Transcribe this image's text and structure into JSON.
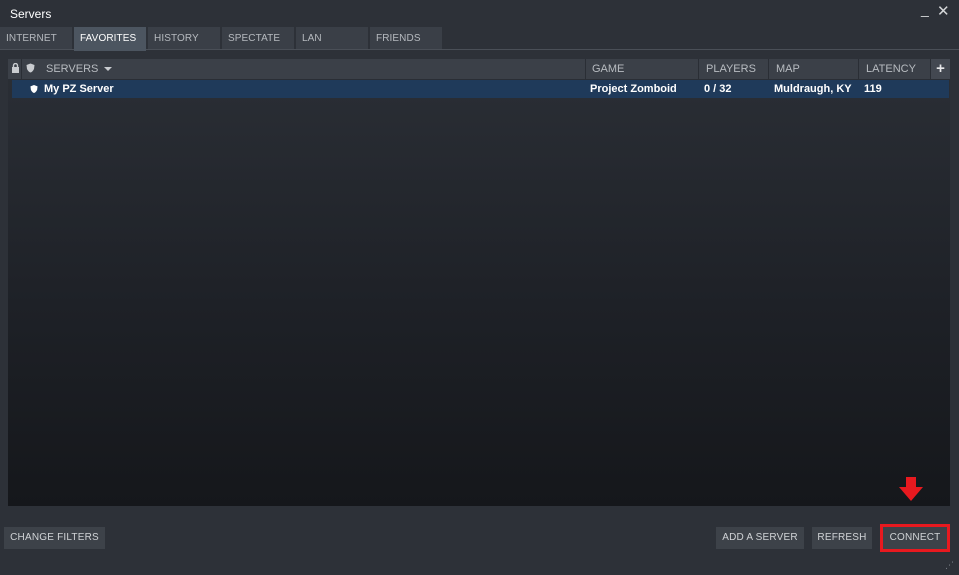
{
  "window": {
    "title": "Servers"
  },
  "tabs": [
    {
      "label": "INTERNET",
      "active": false
    },
    {
      "label": "FAVORITES",
      "active": true
    },
    {
      "label": "HISTORY",
      "active": false
    },
    {
      "label": "SPECTATE",
      "active": false
    },
    {
      "label": "LAN",
      "active": false
    },
    {
      "label": "FRIENDS",
      "active": false
    }
  ],
  "columns": {
    "servers": "SERVERS",
    "game": "GAME",
    "players": "PLAYERS",
    "map": "MAP",
    "latency": "LATENCY"
  },
  "servers": [
    {
      "name": "My PZ Server",
      "game": "Project Zomboid",
      "players": "0 / 32",
      "map": "Muldraugh, KY",
      "latency": "119",
      "selected": true
    }
  ],
  "buttons": {
    "change_filters": "CHANGE FILTERS",
    "add_server": "ADD A SERVER",
    "refresh": "REFRESH",
    "connect": "CONNECT"
  },
  "colors": {
    "highlight": "#e8191f",
    "selected_row": "#1f3a5a",
    "window_bg": "#2d3138"
  },
  "icons": {
    "minimize": "minimize-icon",
    "close": "close-icon",
    "lock": "lock-icon",
    "shield": "shield-icon",
    "sort": "sort-down-icon",
    "add_column": "plus-icon",
    "arrow": "down-arrow-icon"
  }
}
